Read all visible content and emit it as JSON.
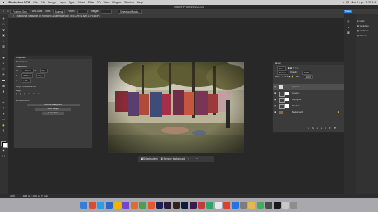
{
  "menubar": {
    "apple": "",
    "app_name": "Photoshop 2024",
    "items": [
      "File",
      "Edit",
      "Image",
      "Layer",
      "Type",
      "Select",
      "Filter",
      "3D",
      "View",
      "Plugins",
      "Window",
      "Help"
    ],
    "clock": "Mon 8 Apr 11:23 AM"
  },
  "window": {
    "title": "Adobe Photoshop 2024"
  },
  "options_bar": {
    "feather": "Feather: 0 px",
    "anti_alias": "Anti-alias",
    "style_label": "Style:",
    "style_value": "Normal",
    "width_label": "Width:",
    "height_label": "Height:",
    "select_mask": "Select and Mask...",
    "share": "Share"
  },
  "document": {
    "tab_title": "Traditional weavings of Highland Guatemalan.jpg @ 100% (Layer 1, RGB/8*)"
  },
  "status": {
    "zoom": "100%",
    "info": "1400 px x 1000 px (72 ppi)"
  },
  "properties": {
    "title": "Properties",
    "kind": "Pixel Layer",
    "transform_label": "Transform",
    "w_label": "W",
    "w_value": "1400 px",
    "x_label": "X",
    "x_value": "0 px",
    "h_label": "H",
    "h_value": "1000 px",
    "y_value": "0 px",
    "angle": "0.00°",
    "align_label": "Align and Distribute",
    "align_sub": "Align:",
    "quick_actions": "Quick Actions",
    "remove_bg": "Remove Background",
    "select_subject": "Select Subject",
    "more": "Learn More"
  },
  "taskbar": {
    "select_subject": "Select subject",
    "remove_bg": "Remove background"
  },
  "layers": {
    "title": "Layers",
    "kind": "Kind",
    "mode": "Normal",
    "opacity_label": "Opacity:",
    "opacity": "100%",
    "lock_label": "Lock:",
    "fill_label": "Fill:",
    "fill": "100%",
    "rows": [
      {
        "name": "Layer 1"
      },
      {
        "name": "Curves 1"
      },
      {
        "name": "Highlights"
      },
      {
        "name": "Shadows"
      },
      {
        "name": "Background"
      }
    ]
  },
  "right_dock": {
    "items": [
      "Color",
      "Swatches",
      "Gradients",
      "Patterns"
    ]
  },
  "colors": {
    "accent": "#2d7ce0",
    "panel": "#3b3b3b",
    "canvas": "#282828"
  }
}
